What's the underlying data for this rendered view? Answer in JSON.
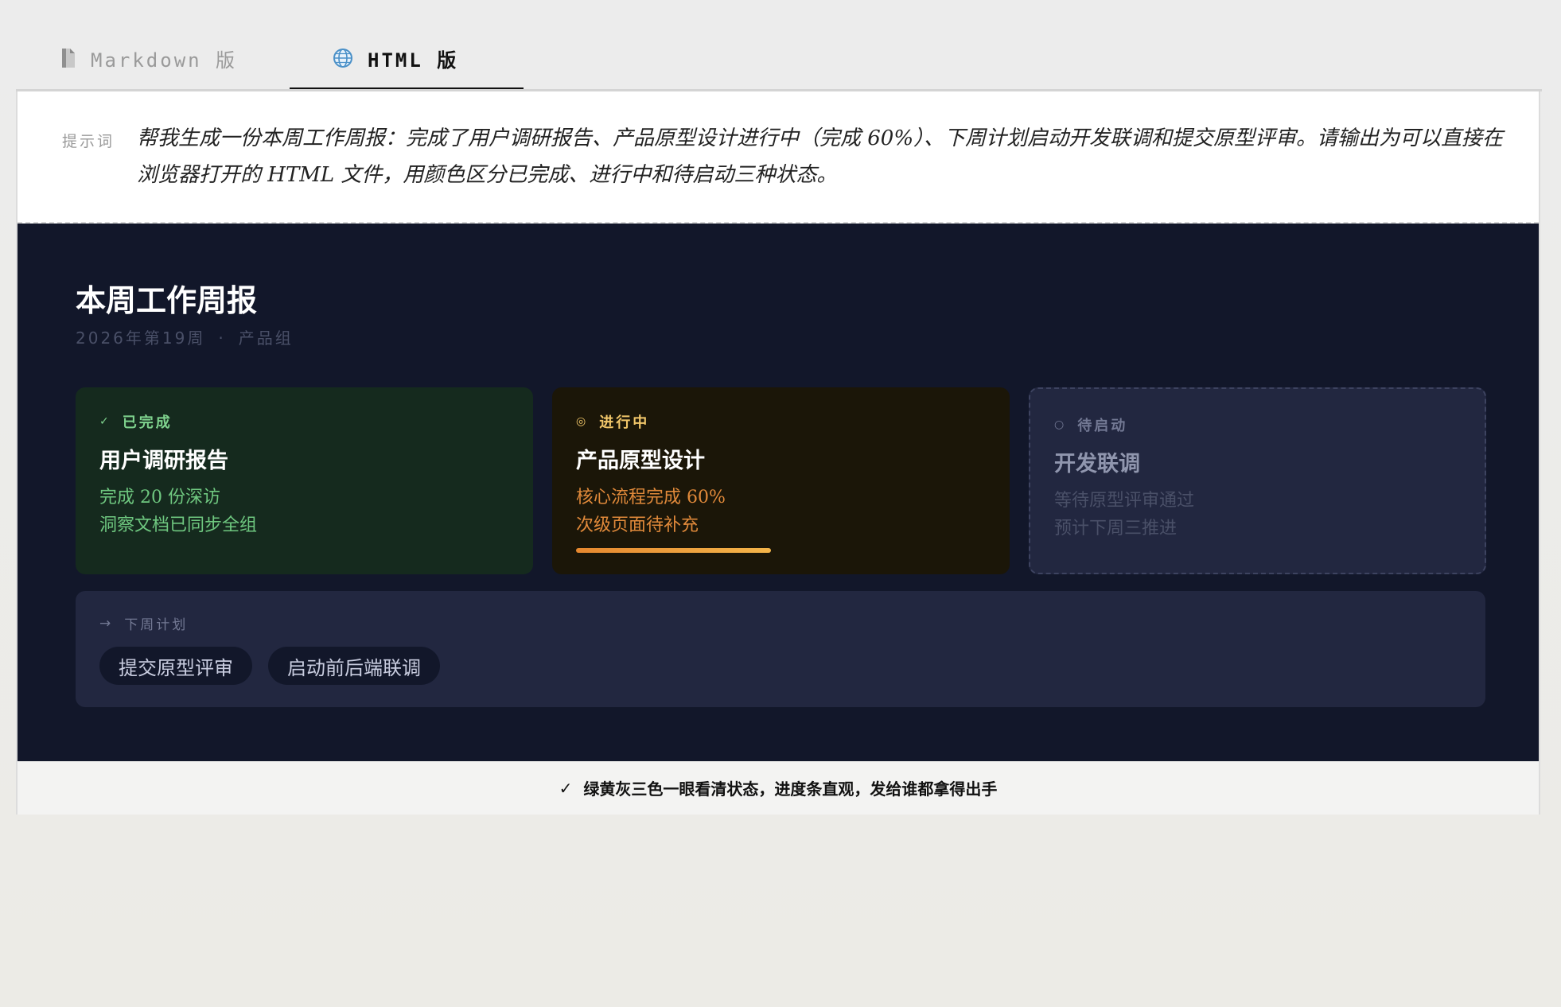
{
  "tabs": [
    {
      "label": "Markdown 版",
      "icon": "document-icon",
      "active": false
    },
    {
      "label": "HTML 版",
      "icon": "globe-icon",
      "active": true
    }
  ],
  "prompt": {
    "label": "提示词",
    "text": "帮我生成一份本周工作周报：完成了用户调研报告、产品原型设计进行中（完成 60%）、下周计划启动开发联调和提交原型评审。请输出为可以直接在浏览器打开的 HTML 文件，用颜色区分已完成、进行中和待启动三种状态。"
  },
  "report": {
    "title": "本周工作周报",
    "meta_week": "2026年第19周",
    "meta_sep": "·",
    "meta_team": "产品组",
    "statuses": [
      {
        "tag": "已完成",
        "symbol": "✓",
        "name": "用户调研报告",
        "line1": "完成 20 份深访",
        "line2": "洞察文档已同步全组",
        "color": "#7fd38e"
      },
      {
        "tag": "进行中",
        "symbol": "◎",
        "name": "产品原型设计",
        "line1": "核心流程完成 60%",
        "line2": "次级页面待补充",
        "progress": 0.48,
        "color": "#f2c76a"
      },
      {
        "tag": "待启动",
        "symbol": "○",
        "name": "开发联调",
        "line1": "等待原型评审通过",
        "line2": "预计下周三推进",
        "color": "#737994"
      }
    ],
    "next": {
      "symbol": "→",
      "label": "下周计划",
      "items": [
        "提交原型评审",
        "启动前后端联调"
      ]
    }
  },
  "footer": {
    "check": "✓",
    "text": "绿黄灰三色一眼看清状态，进度条直观，发给谁都拿得出手"
  }
}
